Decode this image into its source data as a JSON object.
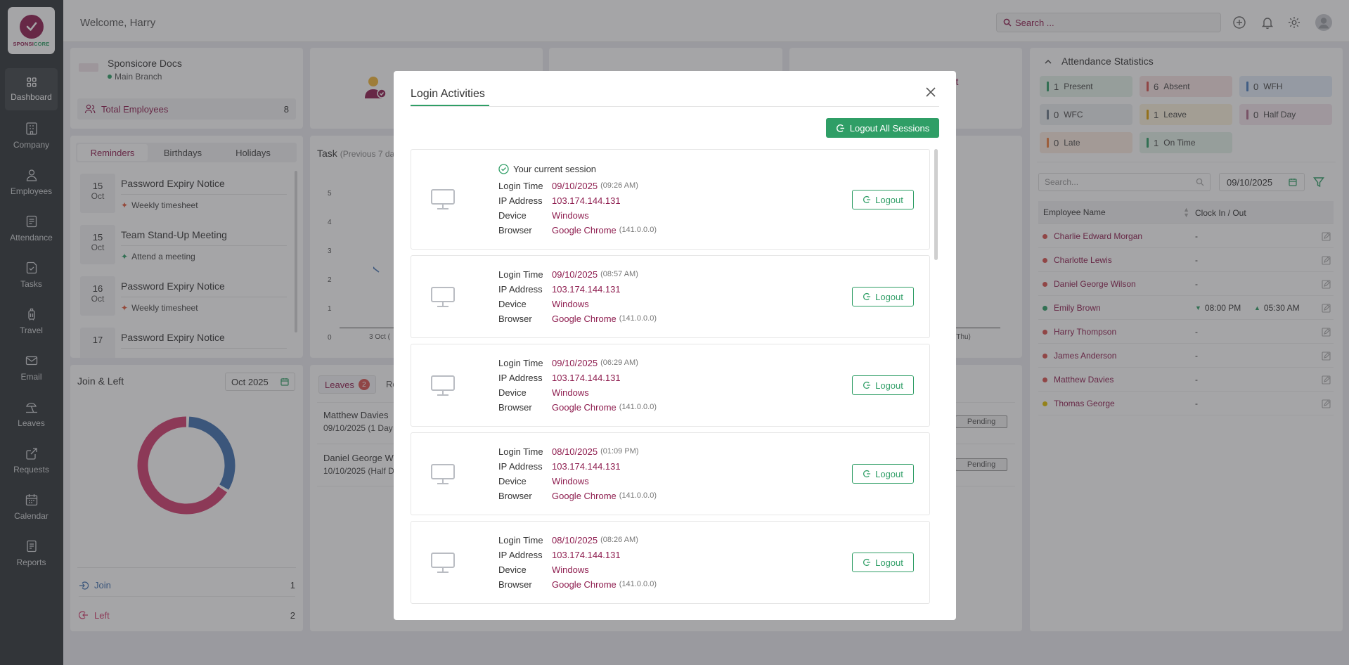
{
  "logo": {
    "text_a": "SPONSI",
    "text_b": "CORE"
  },
  "sidebar": {
    "items": [
      {
        "label": "Dashboard",
        "icon": "grid-icon"
      },
      {
        "label": "Company",
        "icon": "building-icon"
      },
      {
        "label": "Employees",
        "icon": "user-icon"
      },
      {
        "label": "Attendance",
        "icon": "clipboard-icon"
      },
      {
        "label": "Tasks",
        "icon": "task-icon"
      },
      {
        "label": "Travel",
        "icon": "luggage-icon"
      },
      {
        "label": "Email",
        "icon": "mail-icon"
      },
      {
        "label": "Leaves",
        "icon": "beach-icon"
      },
      {
        "label": "Requests",
        "icon": "request-icon"
      },
      {
        "label": "Calendar",
        "icon": "calendar-icon"
      },
      {
        "label": "Reports",
        "icon": "report-icon"
      }
    ]
  },
  "header": {
    "welcome": "Welcome, Harry",
    "search_placeholder": "Search ..."
  },
  "company": {
    "name": "Sponsicore Docs",
    "branch": "Main Branch",
    "total_label": "Total Employees",
    "total_value": "8"
  },
  "reminders": {
    "tabs": [
      "Reminders",
      "Birthdays",
      "Holidays"
    ],
    "items": [
      {
        "day": "15",
        "month": "Oct",
        "title": "Password Expiry Notice",
        "sub": "Weekly timesheet"
      },
      {
        "day": "15",
        "month": "Oct",
        "title": "Team Stand-Up Meeting",
        "sub": "Attend a meeting"
      },
      {
        "day": "16",
        "month": "Oct",
        "title": "Password Expiry Notice",
        "sub": "Weekly timesheet"
      },
      {
        "day": "17",
        "month": "",
        "title": "Password Expiry Notice",
        "sub": ""
      }
    ]
  },
  "task": {
    "title": "Task",
    "subtitle": "(Previous 7 da",
    "y_ticks": [
      "5",
      "4",
      "3",
      "2",
      "1",
      "0"
    ],
    "x_first": "3 Oct (",
    "x_last": "(Thu)"
  },
  "join_left": {
    "title": "Join & Left",
    "month": "Oct 2025",
    "join_label": "Join",
    "join_value": "1",
    "left_label": "Left",
    "left_value": "2"
  },
  "chart_data": {
    "type": "pie",
    "categories": [
      "Join",
      "Left"
    ],
    "values": [
      1,
      2
    ],
    "colors": [
      "#3e6fb0",
      "#d23b6e"
    ]
  },
  "leaves": {
    "tab": "Leaves",
    "badge": "2",
    "tab2": "Re",
    "rows": [
      {
        "name": "Matthew Davies",
        "date": "09/10/2025 (1 Day",
        "status": "Pending"
      },
      {
        "name": "Daniel George Wi",
        "date": "10/10/2025 (Half D",
        "status": "Pending"
      }
    ]
  },
  "alert_fragment": "ert",
  "attendance": {
    "title": "Attendance Statistics",
    "stats": [
      {
        "n": "1",
        "label": "Present",
        "color": "#2f9e66",
        "bg": "#e3f2ea"
      },
      {
        "n": "6",
        "label": "Absent",
        "color": "#d9534f",
        "bg": "#f8e4e4"
      },
      {
        "n": "0",
        "label": "WFH",
        "color": "#4a7fc1",
        "bg": "#e2ecf7"
      },
      {
        "n": "0",
        "label": "WFC",
        "color": "#6c7a89",
        "bg": "#eceef1"
      },
      {
        "n": "1",
        "label": "Leave",
        "color": "#e0a100",
        "bg": "#fbf3dc"
      },
      {
        "n": "0",
        "label": "Half Day",
        "color": "#b06a8b",
        "bg": "#f4e6ed"
      },
      {
        "n": "0",
        "label": "Late",
        "color": "#f0803c",
        "bg": "#fcebe0"
      },
      {
        "n": "1",
        "label": "On Time",
        "color": "#2f9e66",
        "bg": "#e3f2ea"
      }
    ],
    "search_placeholder": "Search...",
    "date": "09/10/2025",
    "col_name": "Employee Name",
    "col_clock": "Clock In / Out",
    "employees": [
      {
        "name": "Charlie Edward Morgan",
        "status": "#d9534f",
        "clock": "-"
      },
      {
        "name": "Charlotte Lewis",
        "status": "#d9534f",
        "clock": "-"
      },
      {
        "name": "Daniel George Wilson",
        "status": "#d9534f",
        "clock": "-"
      },
      {
        "name": "Emily Brown",
        "status": "#2f9e66",
        "clock_in": "08:00 PM",
        "clock_out": "05:30 AM"
      },
      {
        "name": "Harry Thompson",
        "status": "#d9534f",
        "clock": "-"
      },
      {
        "name": "James Anderson",
        "status": "#d9534f",
        "clock": "-"
      },
      {
        "name": "Matthew Davies",
        "status": "#d9534f",
        "clock": "-"
      },
      {
        "name": "Thomas George",
        "status": "#e0c000",
        "clock": "-"
      }
    ]
  },
  "modal": {
    "title": "Login Activities",
    "logout_all": "Logout All Sessions",
    "current_label": "Your current session",
    "labels": {
      "time": "Login Time",
      "ip": "IP Address",
      "device": "Device",
      "browser": "Browser"
    },
    "logout_label": "Logout",
    "sessions": [
      {
        "date": "09/10/2025",
        "time": "(09:26 AM)",
        "ip": "103.174.144.131",
        "device": "Windows",
        "browser": "Google Chrome",
        "version": "(141.0.0.0)"
      },
      {
        "date": "09/10/2025",
        "time": "(08:57 AM)",
        "ip": "103.174.144.131",
        "device": "Windows",
        "browser": "Google Chrome",
        "version": "(141.0.0.0)"
      },
      {
        "date": "09/10/2025",
        "time": "(06:29 AM)",
        "ip": "103.174.144.131",
        "device": "Windows",
        "browser": "Google Chrome",
        "version": "(141.0.0.0)"
      },
      {
        "date": "08/10/2025",
        "time": "(01:09 PM)",
        "ip": "103.174.144.131",
        "device": "Windows",
        "browser": "Google Chrome",
        "version": "(141.0.0.0)"
      },
      {
        "date": "08/10/2025",
        "time": "(08:26 AM)",
        "ip": "103.174.144.131",
        "device": "Windows",
        "browser": "Google Chrome",
        "version": "(141.0.0.0)"
      }
    ]
  }
}
